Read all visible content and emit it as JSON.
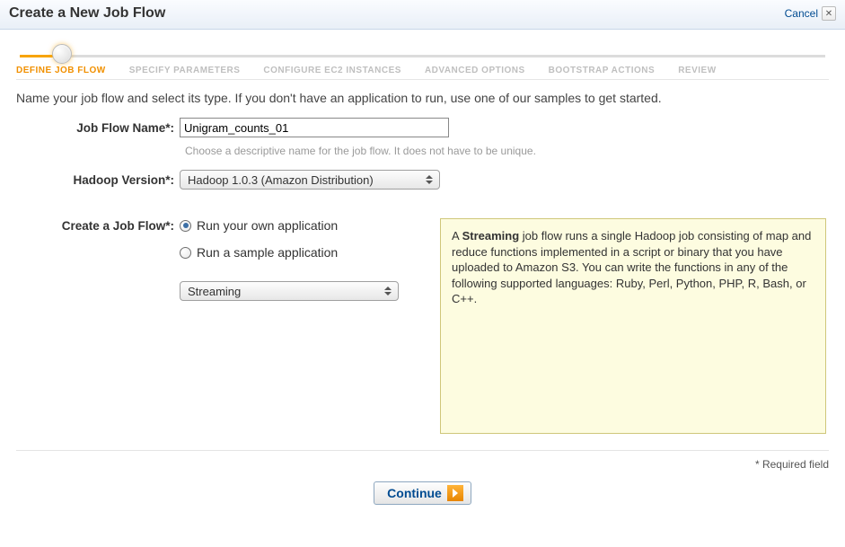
{
  "header": {
    "title": "Create a New Job Flow",
    "cancel": "Cancel"
  },
  "wizard": [
    "DEFINE JOB FLOW",
    "SPECIFY PARAMETERS",
    "CONFIGURE EC2 INSTANCES",
    "ADVANCED OPTIONS",
    "BOOTSTRAP ACTIONS",
    "REVIEW"
  ],
  "intro": "Name your job flow and select its type. If you don't have an application to run, use one of our samples to get started.",
  "form": {
    "jobflow_name_label": "Job Flow Name*:",
    "jobflow_name_value": "Unigram_counts_01",
    "jobflow_name_hint": "Choose a descriptive name for the job flow. It does not have to be unique.",
    "hadoop_label": "Hadoop Version*:",
    "hadoop_selected": "Hadoop 1.0.3 (Amazon Distribution)",
    "create_label": "Create a Job Flow*:",
    "radio_own": "Run your own application",
    "radio_sample": "Run a sample application",
    "app_type_selected": "Streaming"
  },
  "info": {
    "prefix": "A ",
    "bold": "Streaming",
    "rest": " job flow runs a single Hadoop job consisting of map and reduce functions implemented in a script or binary that you have uploaded to Amazon S3. You can write the functions in any of the following supported languages: Ruby, Perl, Python, PHP, R, Bash, or C++."
  },
  "footer": {
    "required": "* Required field",
    "continue": "Continue"
  }
}
